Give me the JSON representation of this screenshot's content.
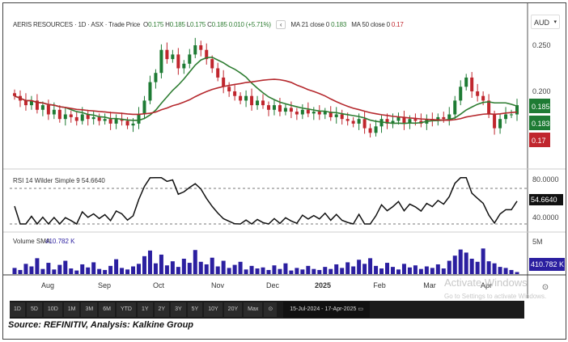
{
  "header": {
    "symbol": "AERIS RESOURCES",
    "interval": "1D",
    "exchange": "ASX",
    "price_type": "Trade Price",
    "o_label": "O",
    "o": "0.175",
    "h_label": "H",
    "h": "0.185",
    "l_label": "L",
    "l": "0.175",
    "c_label": "C",
    "c": "0.185",
    "change": "0.010 (+5.71%)",
    "ma21_label": "MA 21 close 0",
    "ma21_value": "0.183",
    "ma50_label": "MA 50 close 0",
    "ma50_value": "0.17"
  },
  "currency": "AUD",
  "toolbar": {
    "ranges": [
      "1D",
      "5D",
      "10D",
      "1M",
      "3M",
      "6M",
      "YTD",
      "1Y",
      "2Y",
      "3Y",
      "5Y",
      "10Y",
      "20Y",
      "Max"
    ],
    "date_range": "15-Jul-2024  -  17-Apr-2025"
  },
  "source": "Source: REFINITIV, Analysis: Kalkine Group",
  "watermark": {
    "title": "Activate Windows",
    "subtitle": "Go to Settings to activate Windows."
  },
  "colors": {
    "up": "#1e7b34",
    "down": "#c0262d",
    "ma21": "#2e7d32",
    "ma50": "#b5282d",
    "volume": "#2b1fa0",
    "rsi": "#111111"
  },
  "chart_data": {
    "type": "candlestick",
    "x_ticks": [
      "Aug",
      "Sep",
      "Oct",
      "Nov",
      "Dec",
      "2025",
      "Feb",
      "Mar",
      "Apr"
    ],
    "price": {
      "ylim": [
        0.14,
        0.265
      ],
      "y_ticks": [
        "0.250",
        "0.200"
      ],
      "y_tick_values": [
        0.25,
        0.2
      ],
      "close": [
        0.195,
        0.19,
        0.185,
        0.19,
        0.18,
        0.185,
        0.175,
        0.18,
        0.17,
        0.175,
        0.172,
        0.168,
        0.175,
        0.17,
        0.172,
        0.168,
        0.17,
        0.165,
        0.17,
        0.168,
        0.163,
        0.165,
        0.175,
        0.19,
        0.21,
        0.22,
        0.245,
        0.235,
        0.24,
        0.225,
        0.23,
        0.24,
        0.25,
        0.245,
        0.235,
        0.225,
        0.215,
        0.205,
        0.2,
        0.195,
        0.19,
        0.195,
        0.185,
        0.19,
        0.185,
        0.18,
        0.185,
        0.178,
        0.182,
        0.178,
        0.175,
        0.18,
        0.176,
        0.178,
        0.175,
        0.178,
        0.172,
        0.175,
        0.17,
        0.168,
        0.165,
        0.17,
        0.16,
        0.155,
        0.162,
        0.17,
        0.165,
        0.168,
        0.172,
        0.165,
        0.17,
        0.168,
        0.165,
        0.17,
        0.168,
        0.172,
        0.17,
        0.175,
        0.19,
        0.205,
        0.215,
        0.2,
        0.195,
        0.19,
        0.175,
        0.16,
        0.17,
        0.175,
        0.175,
        0.185
      ],
      "last_labels": {
        "close": "0.185",
        "ma21": "0.183",
        "ma50": "0.17"
      }
    },
    "rsi": {
      "title": "RSI 14 Wilder Simple 9",
      "value": "54.6640",
      "ylim": [
        25,
        85
      ],
      "y_ticks": [
        "80.0000",
        "40.0000"
      ],
      "levels": [
        70,
        30
      ]
    },
    "volume": {
      "title": "Volume SMA",
      "value": "410.782 K",
      "y_ticks": [
        "5M"
      ],
      "ymax": 6,
      "values_m": [
        1.2,
        0.8,
        2.0,
        1.5,
        3.1,
        1.0,
        2.2,
        0.9,
        1.8,
        2.6,
        1.1,
        0.7,
        1.9,
        1.3,
        2.3,
        1.0,
        0.8,
        1.6,
        2.9,
        1.2,
        0.9,
        1.5,
        2.0,
        3.5,
        4.6,
        2.1,
        3.8,
        1.7,
        2.5,
        1.4,
        3.0,
        2.2,
        4.7,
        2.4,
        1.9,
        3.2,
        1.5,
        2.6,
        1.2,
        1.8,
        2.4,
        0.9,
        1.6,
        1.1,
        1.3,
        0.8,
        1.7,
        1.0,
        2.1,
        0.7,
        1.2,
        0.9,
        1.6,
        1.0,
        0.8,
        1.4,
        1.0,
        1.9,
        1.2,
        2.3,
        1.5,
        2.8,
        2.0,
        3.1,
        1.6,
        1.1,
        2.2,
        1.4,
        0.9,
        2.0,
        1.3,
        1.7,
        1.0,
        1.5,
        1.2,
        1.9,
        1.1,
        2.6,
        3.6,
        4.8,
        4.2,
        3.0,
        2.4,
        5.0,
        2.5,
        2.1,
        1.4,
        1.2,
        0.8,
        0.4
      ]
    }
  }
}
